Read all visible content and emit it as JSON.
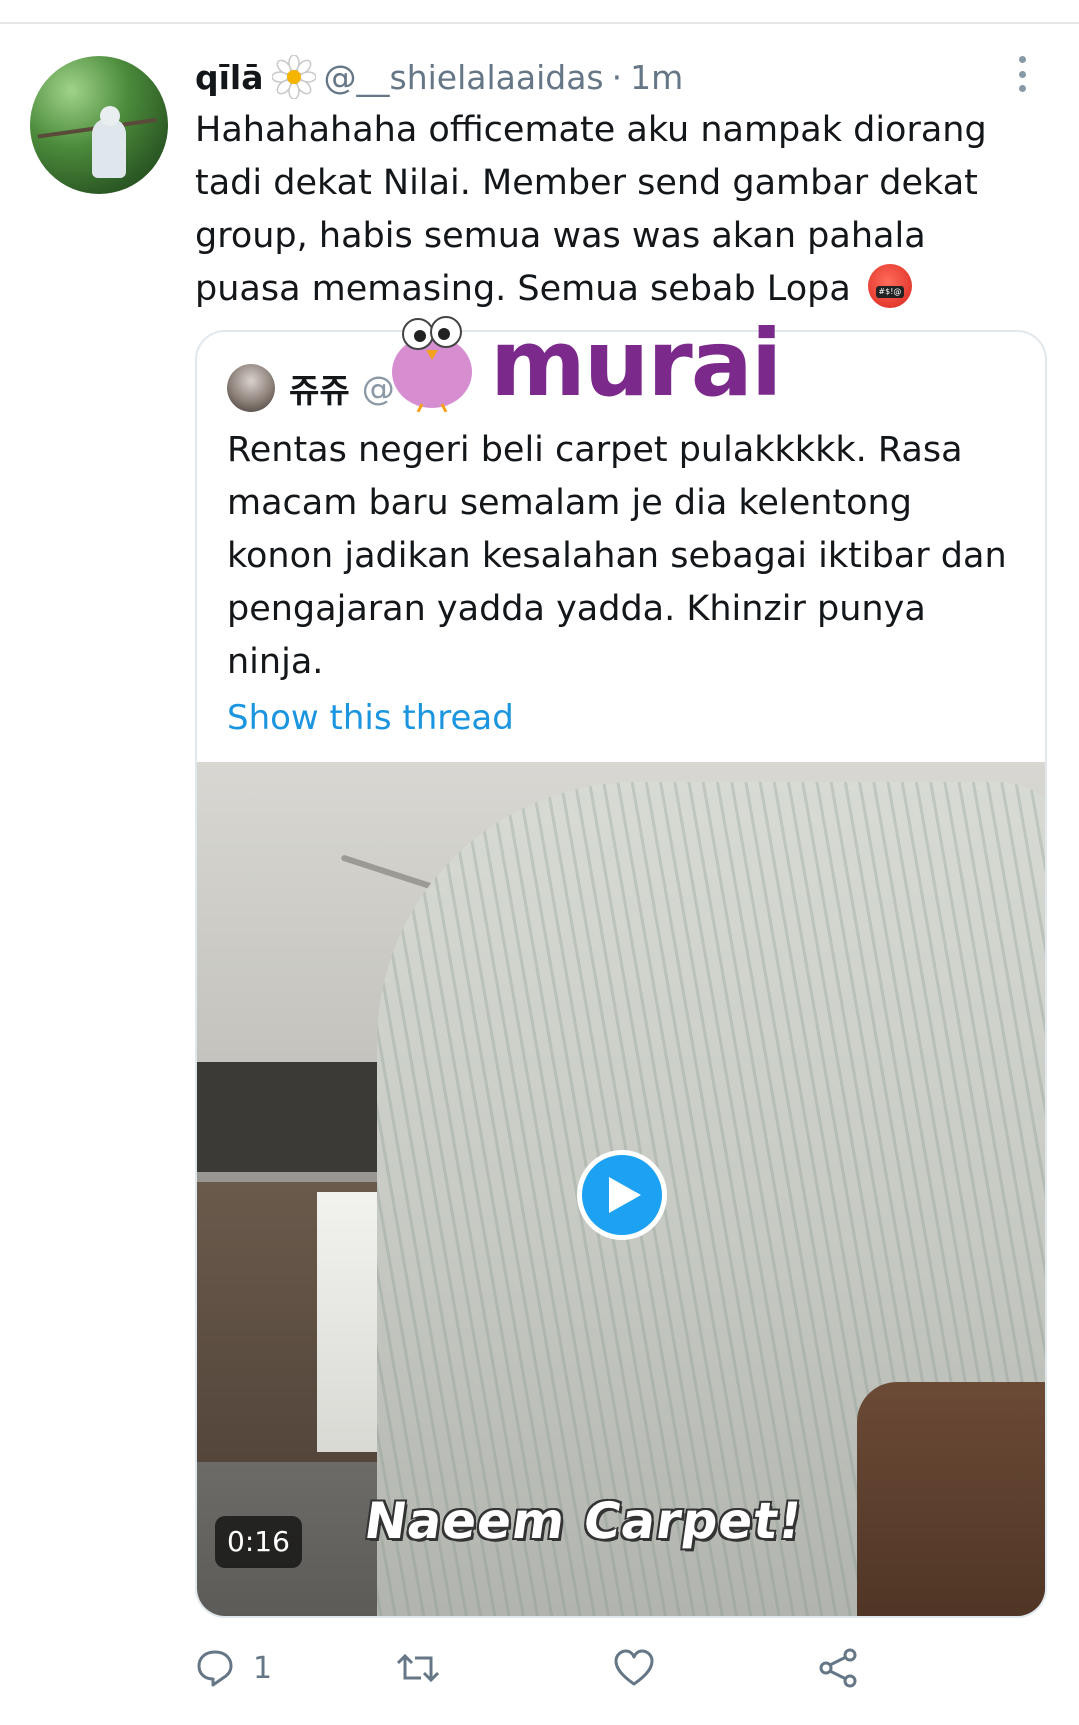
{
  "tweet": {
    "author_name": "qīlā",
    "handle": "@__shielalaaidas",
    "separator": "·",
    "time": "1m",
    "text": "Hahahahaha officemate aku nampak diorang tadi dekat Nilai. Member send gambar dekat group, habis semua was was akan pahala puasa memasing. Semua sebab Lopa",
    "emoji": "angry-face-with-symbols"
  },
  "quoted": {
    "author_name": "쥬쥬",
    "handle_partial": "@",
    "text": "Rentas negeri beli carpet pulakkkkk. Rasa macam baru semalam je dia kelentong konon jadikan kesalahan sebagai iktibar dan pengajaran yadda yadda. Khinzir punya ninja.",
    "show_thread": "Show this thread",
    "video": {
      "duration": "0:16",
      "caption": "Naeem Carpet!"
    }
  },
  "watermark": {
    "text": "murai"
  },
  "actions": {
    "reply_count": "1",
    "icons": [
      "reply-icon",
      "retweet-icon",
      "like-icon",
      "share-icon"
    ]
  },
  "colors": {
    "link": "#1b95e0",
    "muted": "#657786",
    "play": "#1da1f2",
    "watermark": "#7b2a8c"
  }
}
